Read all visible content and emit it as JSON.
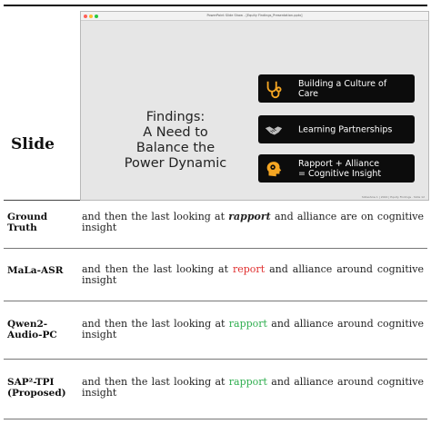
{
  "slide": {
    "row_label": "Slide",
    "window_title": "PowerPoint Slide Show - [Equity Findings_Presentation.pptx]",
    "heading_lines": [
      "Findings:",
      "A Need to",
      "Balance the",
      "Power Dynamic"
    ],
    "cards": [
      {
        "text_lines": [
          "Building a Culture of",
          "Care"
        ],
        "icon": "stethoscope-icon"
      },
      {
        "text_lines": [
          "Learning Partnerships"
        ],
        "icon": "handshake-icon"
      },
      {
        "text_lines": [
          "Rapport + Alliance",
          "= Cognitive Insight"
        ],
        "icon": "head-gears-icon"
      }
    ],
    "footer_text": "Slideshow 1 | 2024 | Equity Findings · Slide 12"
  },
  "colors": {
    "card_bg": "#0c0c0c",
    "error": "#e03030",
    "correct": "#2fae4f",
    "icon_orange": "#f5a623"
  },
  "rows": [
    {
      "label_lines": [
        "Ground",
        "Truth"
      ],
      "segments": [
        {
          "t": "and then the last looking at ",
          "style": "normal"
        },
        {
          "t": "rapport",
          "style": "boldital"
        },
        {
          "t": " and alliance are on cognitive insight",
          "style": "normal"
        }
      ]
    },
    {
      "label_lines": [
        "MaLa-ASR"
      ],
      "segments": [
        {
          "t": "and then the last looking at ",
          "style": "normal"
        },
        {
          "t": "report",
          "style": "red"
        },
        {
          "t": " and alliance around cognitive insight",
          "style": "normal"
        }
      ]
    },
    {
      "label_lines": [
        "Qwen2-",
        "Audio-PC"
      ],
      "segments": [
        {
          "t": "and then the last looking at ",
          "style": "normal"
        },
        {
          "t": "rapport",
          "style": "green"
        },
        {
          "t": " and alliance around cognitive insight",
          "style": "normal"
        }
      ]
    },
    {
      "label_lines": [
        "SAP²-TPI",
        "(Proposed)"
      ],
      "segments": [
        {
          "t": "and then the last looking at ",
          "style": "normal"
        },
        {
          "t": "rapport",
          "style": "green"
        },
        {
          "t": " and alliance around cognitive insight",
          "style": "normal"
        }
      ]
    }
  ]
}
